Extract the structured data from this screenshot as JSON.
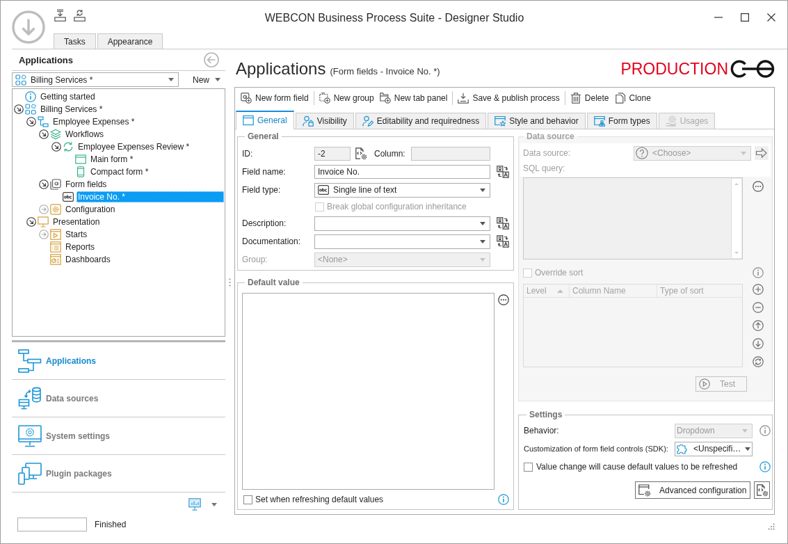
{
  "window": {
    "title": "WEBCON Business Process Suite - Designer Studio"
  },
  "ribbon_tabs": [
    {
      "label": "Tasks",
      "selected": false
    },
    {
      "label": "Appearance",
      "selected": false
    }
  ],
  "sidebar": {
    "title": "Applications",
    "application_picker": {
      "value": "Billing Services *"
    },
    "new_menu": {
      "label": "New"
    },
    "tree": [
      {
        "label": "Getting started",
        "kind": "info",
        "selected": false
      },
      {
        "label": "Billing Services *",
        "kind": "application",
        "selected": false,
        "expanded": true,
        "children": [
          {
            "label": "Employee Expenses *",
            "kind": "process",
            "selected": false,
            "expanded": true,
            "children": [
              {
                "label": "Workflows",
                "kind": "workflows",
                "selected": false,
                "expanded": true,
                "children": [
                  {
                    "label": "Employee Expenses Review *",
                    "kind": "workflow",
                    "selected": false,
                    "expanded": true,
                    "children": [
                      {
                        "label": "Main form *",
                        "kind": "form",
                        "selected": false
                      },
                      {
                        "label": "Compact form *",
                        "kind": "compact-form",
                        "selected": false
                      }
                    ]
                  }
                ]
              },
              {
                "label": "Form fields",
                "kind": "form-fields",
                "selected": false,
                "expanded": true,
                "children": [
                  {
                    "label": "Invoice No. *",
                    "kind": "text-field",
                    "selected": true
                  }
                ]
              },
              {
                "label": "Configuration",
                "kind": "configuration",
                "selected": false,
                "expanded": false
              }
            ]
          },
          {
            "label": "Presentation",
            "kind": "presentation",
            "selected": false,
            "expanded": true,
            "children": [
              {
                "label": "Starts",
                "kind": "starts",
                "selected": false,
                "expanded": false
              },
              {
                "label": "Reports",
                "kind": "reports",
                "selected": false
              },
              {
                "label": "Dashboards",
                "kind": "dashboards",
                "selected": false
              }
            ]
          }
        ]
      }
    ]
  },
  "nav": [
    {
      "label": "Applications",
      "kind": "applications",
      "selected": true
    },
    {
      "label": "Data sources",
      "kind": "data-sources",
      "selected": false
    },
    {
      "label": "System settings",
      "kind": "system-settings",
      "selected": false
    },
    {
      "label": "Plugin packages",
      "kind": "plugin-packages",
      "selected": false
    }
  ],
  "status_bar": {
    "progress": {
      "level": 0
    },
    "text": "Finished"
  },
  "main": {
    "heading": "Applications",
    "context": "(Form fields - Invoice No. *)",
    "environment": "PRODUCTION",
    "toolbar": [
      [
        {
          "label": "New form field",
          "kind": "new-field"
        }
      ],
      [
        {
          "label": "New group",
          "kind": "new-group"
        },
        {
          "label": "New tab panel",
          "kind": "new-tab-panel"
        }
      ],
      [
        {
          "label": "Save & publish process",
          "kind": "publish"
        }
      ],
      [
        {
          "label": "Delete",
          "kind": "delete"
        },
        {
          "label": "Clone",
          "kind": "clone"
        }
      ]
    ],
    "tabs": [
      {
        "label": "General",
        "kind": "general",
        "selected": true,
        "disabled": false
      },
      {
        "label": "Visibility",
        "kind": "visibility",
        "selected": false,
        "disabled": false
      },
      {
        "label": "Editability and requiredness",
        "kind": "editability",
        "selected": false,
        "disabled": false
      },
      {
        "label": "Style and behavior",
        "kind": "style",
        "selected": false,
        "disabled": false
      },
      {
        "label": "Form types",
        "kind": "form-types",
        "selected": false,
        "disabled": false
      },
      {
        "label": "Usages",
        "kind": "usages",
        "selected": false,
        "disabled": true
      }
    ],
    "general": {
      "title": "General",
      "id": {
        "label": "ID:",
        "value": "-2"
      },
      "column": {
        "label": "Column:"
      },
      "field_name": {
        "label": "Field name:",
        "value": "Invoice No."
      },
      "field_type": {
        "label": "Field type:",
        "value": "Single line of text"
      },
      "inheritance": {
        "label": "Break global configuration inheritance",
        "checked": false,
        "disabled": true
      },
      "description": {
        "label": "Description:"
      },
      "documentation": {
        "label": "Documentation:"
      },
      "group": {
        "label": "Group:",
        "value": "<None>",
        "disabled": true
      }
    },
    "default_value": {
      "title": "Default value",
      "refresh_option": {
        "label": "Set when refreshing default values",
        "checked": false
      }
    },
    "data_source": {
      "title": "Data source",
      "disabled": true,
      "source": {
        "label": "Data source:",
        "value": "<Choose>"
      },
      "query_label": "SQL query:",
      "override_sort": {
        "label": "Override sort",
        "checked": false
      },
      "sort_columns": [
        {
          "label": "Level",
          "sorted": true
        },
        {
          "label": "Column Name",
          "sorted": false
        },
        {
          "label": "Type of sort",
          "sorted": false
        }
      ],
      "test_button": {
        "label": "Test"
      }
    },
    "settings": {
      "title": "Settings",
      "behavior": {
        "label": "Behavior:",
        "value": "Dropdown",
        "disabled": true
      },
      "sdk": {
        "label": "Customization of form field controls (SDK):",
        "value": "<Unspecifi…"
      },
      "refresh_option": {
        "label": "Value change will cause default values to be refreshed",
        "checked": false
      },
      "advanced_button": {
        "label": "Advanced configuration"
      }
    }
  }
}
